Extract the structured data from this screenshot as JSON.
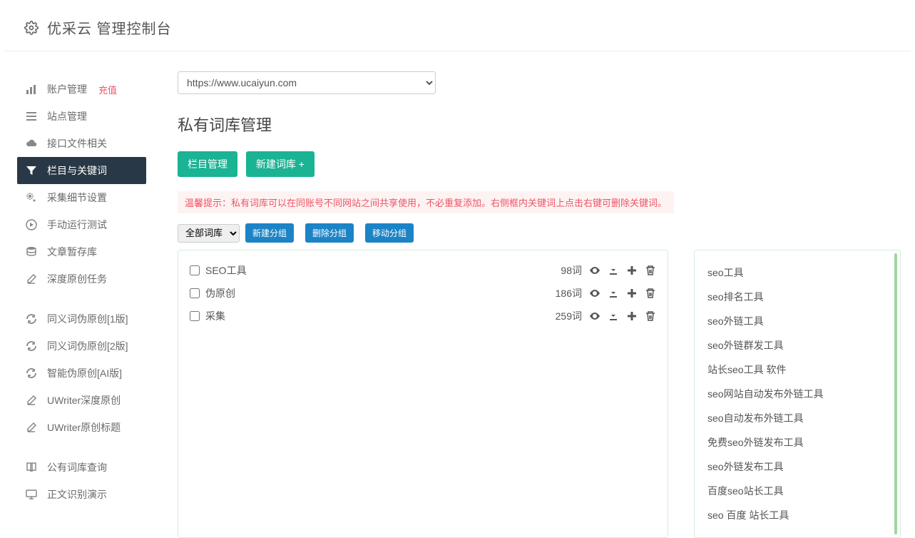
{
  "header": {
    "title": "优采云 管理控制台"
  },
  "sidebar": {
    "items": [
      {
        "label": "账户管理",
        "badge": "充值",
        "icon": "bar-chart-icon"
      },
      {
        "label": "站点管理",
        "icon": "list-icon"
      },
      {
        "label": "接口文件相关",
        "icon": "cloud-icon"
      },
      {
        "label": "栏目与关键词",
        "icon": "filter-icon",
        "active": true
      },
      {
        "label": "采集细节设置",
        "icon": "cogs-icon"
      },
      {
        "label": "手动运行测试",
        "icon": "play-icon"
      },
      {
        "label": "文章暂存库",
        "icon": "database-icon"
      },
      {
        "label": "深度原创任务",
        "icon": "edit-icon"
      }
    ],
    "items2": [
      {
        "label": "同义词伪原创[1版]",
        "icon": "refresh-icon"
      },
      {
        "label": "同义词伪原创[2版]",
        "icon": "refresh-icon"
      },
      {
        "label": "智能伪原创[AI版]",
        "icon": "refresh-icon"
      },
      {
        "label": "UWriter深度原创",
        "icon": "edit-icon"
      },
      {
        "label": "UWriter原创标题",
        "icon": "edit-icon"
      }
    ],
    "items3": [
      {
        "label": "公有词库查询",
        "icon": "book-icon"
      },
      {
        "label": "正文识别演示",
        "icon": "monitor-icon"
      }
    ]
  },
  "main": {
    "site_select": "https://www.ucaiyun.com",
    "page_title": "私有词库管理",
    "btn_manage": "栏目管理",
    "btn_new": "新建词库 +",
    "tip": "温馨提示：私有词库可以在同账号不同网站之间共享使用，不必重复添加。右侧框内关键词上点击右键可删除关键词。",
    "group_select": "全部词库",
    "btn_new_group": "新建分组",
    "btn_del_group": "删除分组",
    "btn_move_group": "移动分组",
    "rows": [
      {
        "name": "SEO工具",
        "count": "98词"
      },
      {
        "name": "伪原创",
        "count": "186词"
      },
      {
        "name": "采集",
        "count": "259词"
      }
    ],
    "keywords": [
      "seo工具",
      "seo排名工具",
      "seo外链工具",
      "seo外链群发工具",
      "站长seo工具 软件",
      "seo网站自动发布外链工具",
      "seo自动发布外链工具",
      "免费seo外链发布工具",
      "seo外链发布工具",
      "百度seo站长工具",
      "seo 百度 站长工具"
    ]
  }
}
